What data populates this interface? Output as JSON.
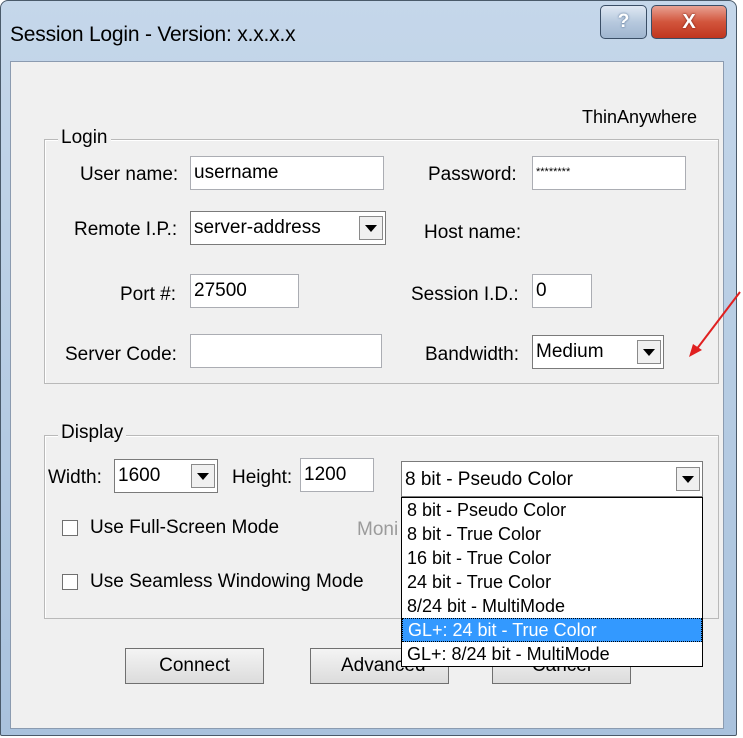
{
  "window": {
    "title": "Session Login - Version: x.x.x.x",
    "help_label": "?",
    "close_label": "X",
    "brand": "ThinAnywhere"
  },
  "login": {
    "legend": "Login",
    "username_label": "User name:",
    "username_value": "username",
    "password_label": "Password:",
    "password_value": "********",
    "remote_ip_label": "Remote I.P.:",
    "remote_ip_value": "server-address",
    "host_name_label": "Host name:",
    "port_label": "Port #:",
    "port_value": "27500",
    "session_id_label": "Session I.D.:",
    "session_id_value": "0",
    "server_code_label": "Server Code:",
    "server_code_value": "",
    "bandwidth_label": "Bandwidth:",
    "bandwidth_value": "Medium"
  },
  "display": {
    "legend": "Display",
    "width_label": "Width:",
    "width_value": "1600",
    "height_label": "Height:",
    "height_value": "1200",
    "color_value": "8 bit - Pseudo Color",
    "fullscreen_label": "Use Full-Screen Mode",
    "monitor_label_partial": "Moni",
    "seamless_label": "Use Seamless Windowing Mode",
    "color_options": [
      "8 bit - Pseudo Color",
      "8 bit - True Color",
      "16 bit - True Color",
      "24 bit - True Color",
      "8/24 bit - MultiMode",
      "GL+: 24 bit - True Color",
      "GL+: 8/24 bit - MultiMode"
    ],
    "highlighted_option": "GL+: 24 bit - True Color"
  },
  "buttons": {
    "connect": "Connect",
    "advanced_partial": "Advanced",
    "cancel": "Cancel"
  },
  "colors": {
    "highlight": "#3399ff",
    "annotation_arrow": "#e02020",
    "close_button": "#c0351e"
  }
}
